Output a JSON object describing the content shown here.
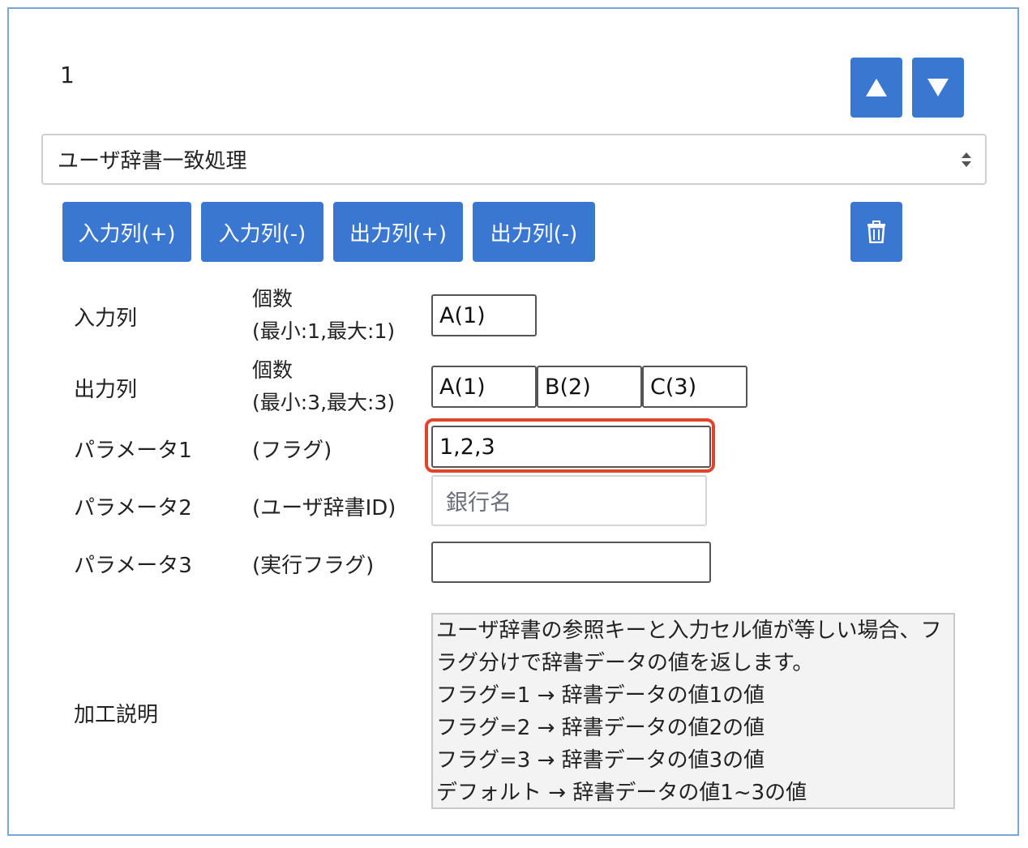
{
  "step": {
    "number": "1"
  },
  "controls": {
    "move_up": "move-up",
    "move_down": "move-down",
    "delete": "delete"
  },
  "process_select": {
    "value": "ユーザ辞書一致処理"
  },
  "toolbar": {
    "add_input_label": "入力列(+)",
    "remove_input_label": "入力列(-)",
    "add_output_label": "出力列(+)",
    "remove_output_label": "出力列(-)"
  },
  "rows": {
    "input": {
      "label": "入力列",
      "count_label": "個数",
      "range": "(最小:1,最大:1)",
      "values": [
        "A(1)"
      ]
    },
    "output": {
      "label": "出力列",
      "count_label": "個数",
      "range": "(最小:3,最大:3)",
      "values": [
        "A(1)",
        "B(2)",
        "C(3)"
      ]
    },
    "param1": {
      "label": "パラメータ1",
      "hint": "(フラグ)",
      "value": "1,2,3"
    },
    "param2": {
      "label": "パラメータ2",
      "hint": "(ユーザ辞書ID)",
      "value": "銀行名"
    },
    "param3": {
      "label": "パラメータ3",
      "hint": "(実行フラグ)",
      "value": ""
    },
    "description": {
      "label": "加工説明",
      "lines": [
        "ユーザ辞書の参照キーと入力セル値が等しい場合、フ",
        "ラグ分けで辞書データの値を返します。",
        "フラグ=1 → 辞書データの値1の値",
        "フラグ=2 → 辞書データの値2の値",
        "フラグ=3 → 辞書データの値3の値",
        "デフォルト → 辞書データの値1~3の値"
      ]
    }
  },
  "icons": {
    "up": "triangle-up-icon",
    "down": "triangle-down-icon",
    "trash": "trash-icon",
    "caret": "sort-caret-icon"
  },
  "colors": {
    "primary_button": "#3a77d1",
    "card_border": "#7aa6d8",
    "focus_highlight": "#e0452c"
  }
}
